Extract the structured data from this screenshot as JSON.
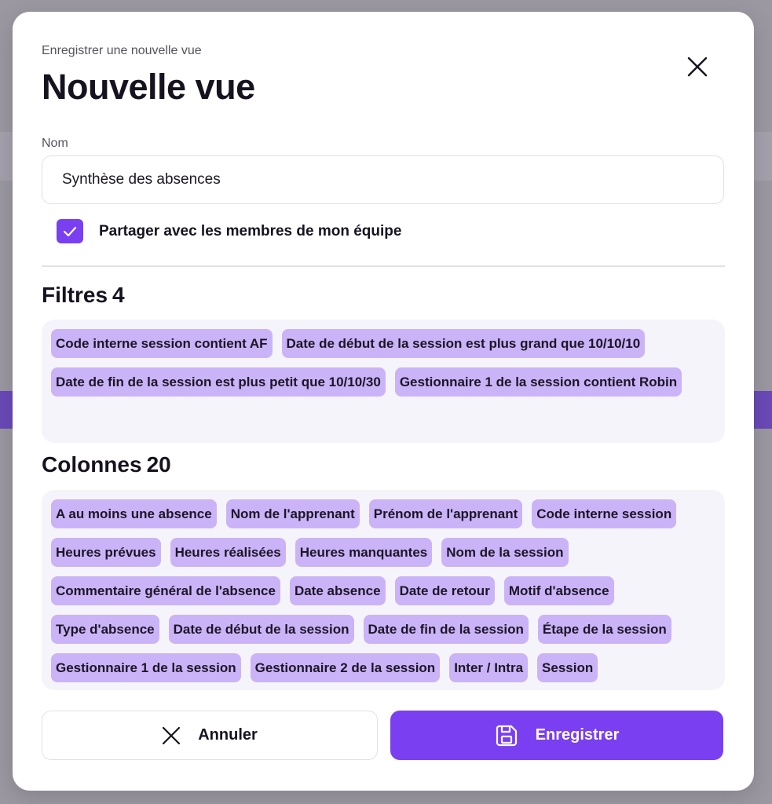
{
  "modal": {
    "subtitle": "Enregistrer une nouvelle vue",
    "title": "Nouvelle vue",
    "close_icon": "close-icon"
  },
  "form": {
    "name_label": "Nom",
    "name_value": "Synthèse des absences",
    "share_checked": true,
    "share_label": "Partager avec les membres de mon équipe"
  },
  "filters": {
    "title": "Filtres",
    "count": "4",
    "chips": [
      "Code interne session contient AF",
      "Date de début de la session est plus grand que 10/10/10",
      "Date de fin de la session est plus petit que 10/10/30",
      "Gestionnaire 1 de la session contient Robin"
    ]
  },
  "columns": {
    "title": "Colonnes",
    "count": "20",
    "chips": [
      "A au moins une absence",
      "Nom de l'apprenant",
      "Prénom de l'apprenant",
      "Code interne session",
      "Heures prévues",
      "Heures réalisées",
      "Heures manquantes",
      "Nom de la session",
      "Commentaire général de l'absence",
      "Date absence",
      "Date de retour",
      "Motif d'absence",
      "Type d'absence",
      "Date de début de la session",
      "Date de fin de la session",
      "Étape de la session",
      "Gestionnaire 1 de la session",
      "Gestionnaire 2 de la session",
      "Inter / Intra",
      "Session"
    ]
  },
  "actions": {
    "cancel_label": "Annuler",
    "cancel_icon": "close-icon",
    "save_label": "Enregistrer",
    "save_icon": "floppy-disk-icon"
  },
  "colors": {
    "accent": "#7a3ff0",
    "chip_bg": "#cbb3f7",
    "chip_box_bg": "#f6f4fb"
  }
}
